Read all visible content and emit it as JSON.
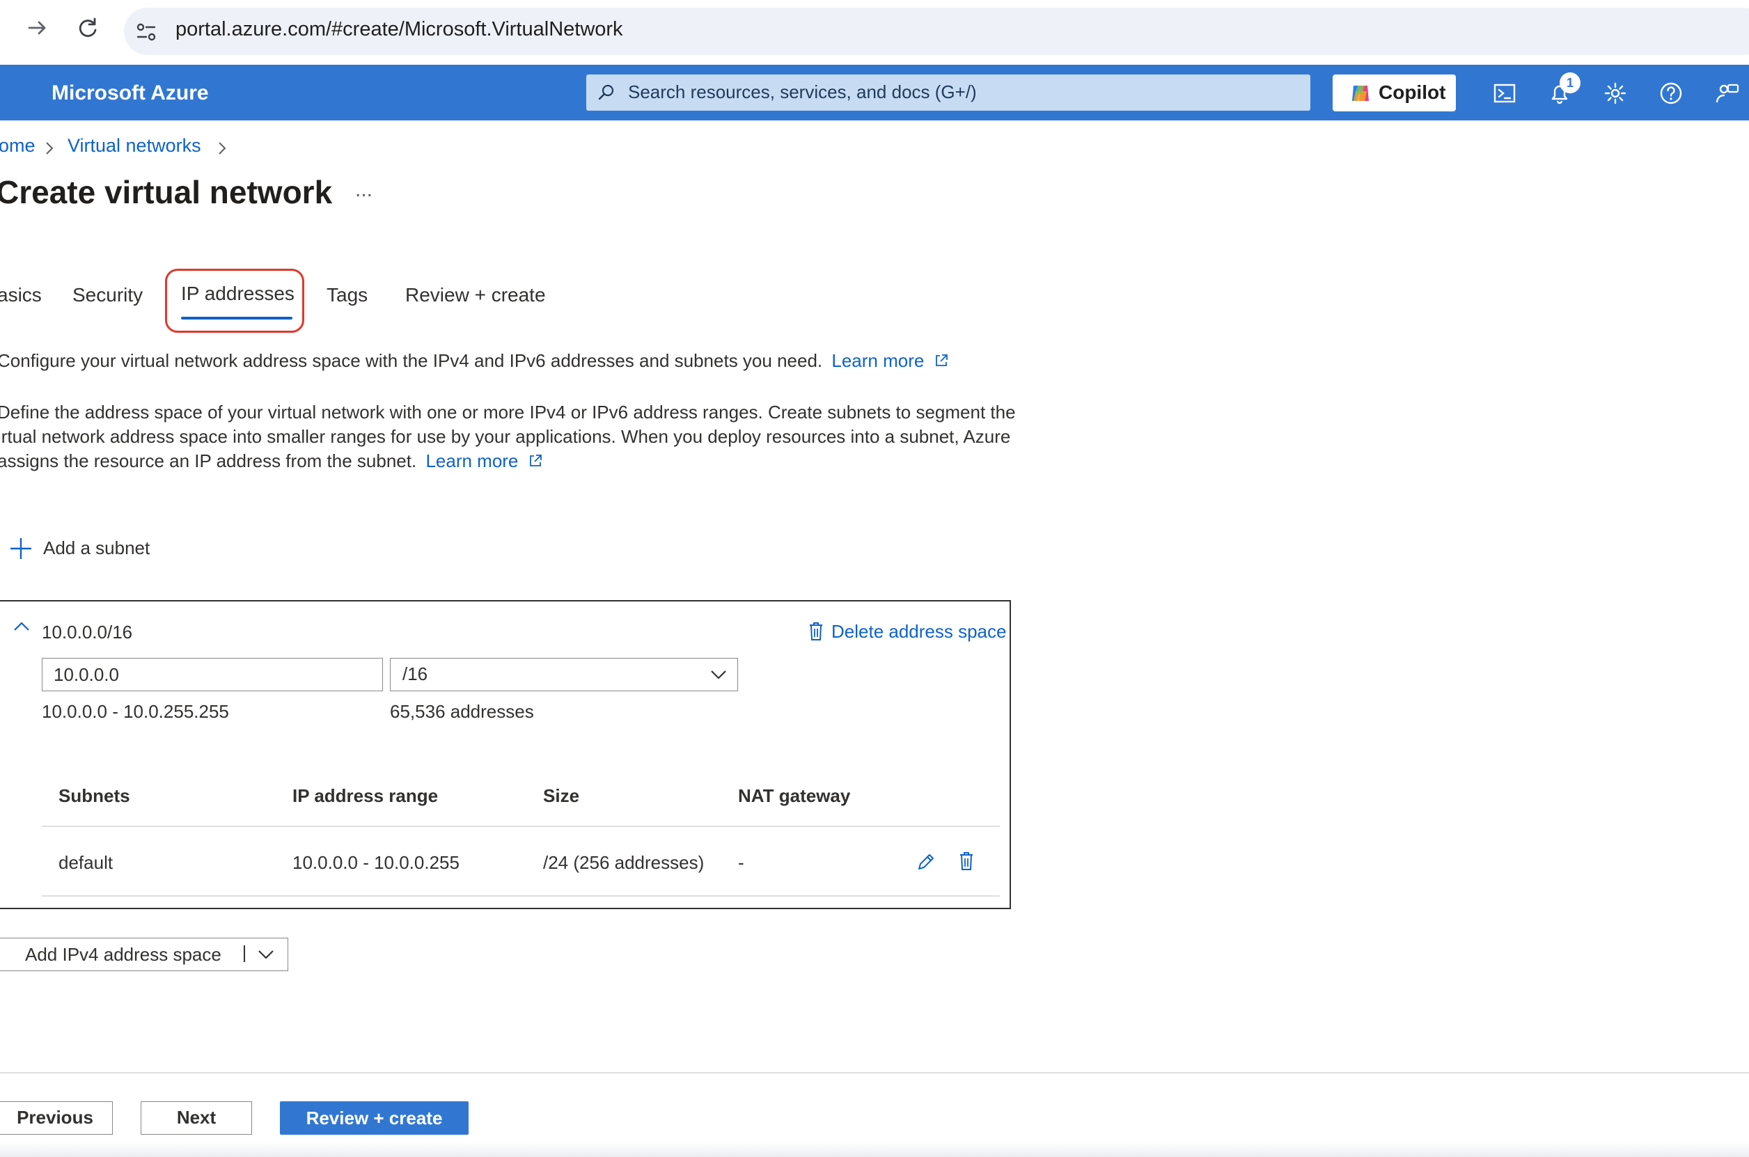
{
  "browser": {
    "url": "portal.azure.com/#create/Microsoft.VirtualNetwork"
  },
  "header": {
    "brand": "Microsoft Azure",
    "search_placeholder": "Search resources, services, and docs (G+/)",
    "copilot_label": "Copilot",
    "notification_count": "1"
  },
  "breadcrumb": {
    "items": [
      "ome",
      "Virtual networks"
    ]
  },
  "page": {
    "title": "Create virtual network",
    "more": "..."
  },
  "tabs": [
    {
      "label": "asics"
    },
    {
      "label": "Security"
    },
    {
      "label": "IP addresses"
    },
    {
      "label": "Tags"
    },
    {
      "label": "Review + create"
    }
  ],
  "intro": {
    "text": "Configure your virtual network address space with the IPv4 and IPv6 addresses and subnets you need.",
    "learn_more": "Learn more"
  },
  "description": {
    "line1": "Define the address space of your virtual network with one or more IPv4 or IPv6 address ranges. Create subnets to segment the",
    "line2": "irtual network address space into smaller ranges for use by your applications. When you deploy resources into a subnet, Azure",
    "line3": "assigns the resource an IP address from the subnet.",
    "learn_more": "Learn more"
  },
  "add_subnet_label": "Add a subnet",
  "address_space": {
    "title": "10.0.0.0/16",
    "delete_label": "Delete address space",
    "ip_value": "10.0.0.0",
    "prefix_value": "/16",
    "range_text": "10.0.0.0 - 10.0.255.255",
    "count_text": "65,536 addresses",
    "columns": [
      "Subnets",
      "IP address range",
      "Size",
      "NAT gateway"
    ],
    "rows": [
      {
        "name": "default",
        "range": "10.0.0.0 - 10.0.0.255",
        "size": "/24 (256 addresses)",
        "nat": "-"
      }
    ]
  },
  "add_ipv4_label": "Add IPv4 address space",
  "footer": {
    "previous": "Previous",
    "next": "Next",
    "review_create": "Review + create"
  },
  "colors": {
    "azure_blue": "#3177d2",
    "link": "#0f62c8",
    "highlight": "#e0382c"
  }
}
